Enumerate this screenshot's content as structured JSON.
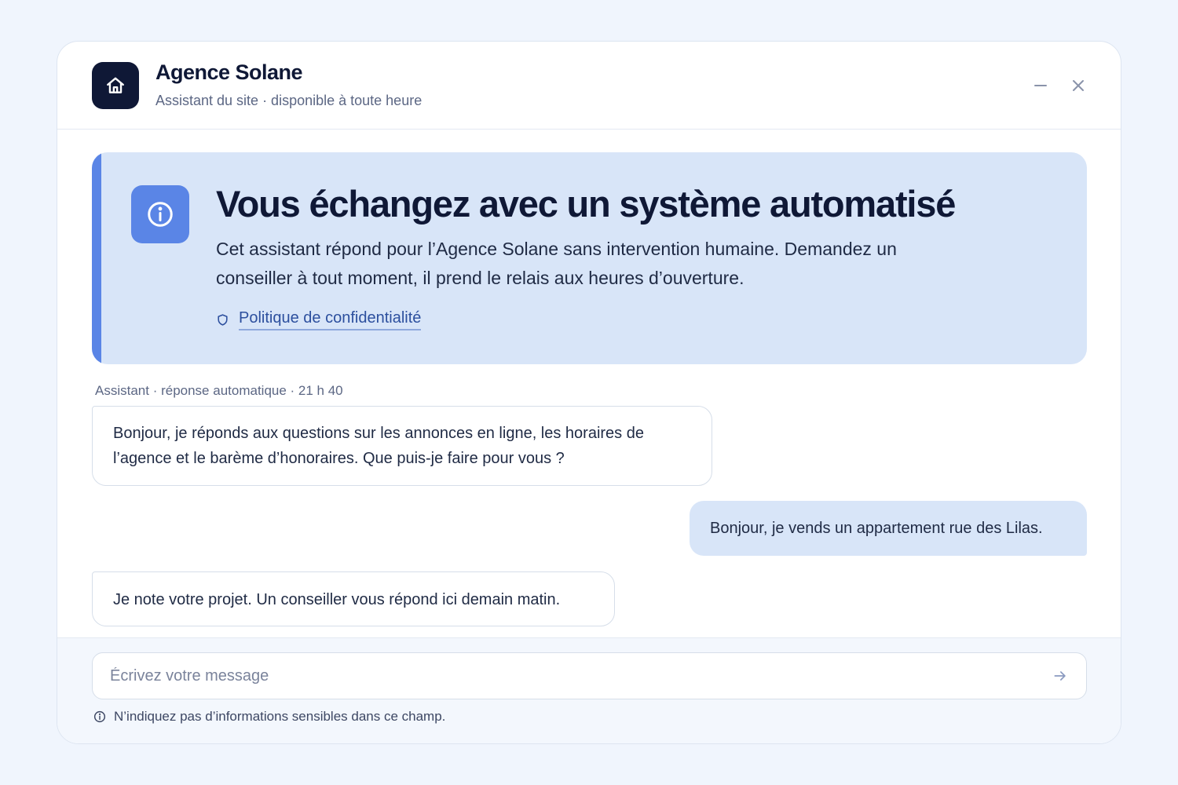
{
  "header": {
    "title": "Agence Solane",
    "subtitle": "Assistant du site · disponible à toute heure",
    "logo_icon": "house-icon",
    "minimize_icon": "minimize-icon",
    "close_icon": "close-icon"
  },
  "banner": {
    "icon": "info-icon",
    "title": "Vous échangez avec un système automatisé",
    "text": "Cet assistant répond pour l’Agence Solane sans intervention humaine. Demandez un conseiller à tout moment, il prend le relais aux heures d’ouverture.",
    "policy_icon": "shield-icon",
    "policy_link": "Politique de confidentialité"
  },
  "conversation": {
    "meta": "Assistant · réponse automatique · 21 h 40",
    "messages": [
      {
        "role": "assistant",
        "text": "Bonjour, je réponds aux questions sur les annonces en ligne, les horaires de l’agence et le barème d’honoraires. Que puis-je faire pour vous ?"
      },
      {
        "role": "user",
        "text": "Bonjour, je vends un appartement rue des Lilas."
      },
      {
        "role": "assistant",
        "text": "Je note votre projet. Un conseiller vous répond ici demain matin."
      }
    ]
  },
  "composer": {
    "placeholder": "Écrivez votre message",
    "value": "",
    "send_icon": "arrow-right-icon",
    "hint_icon": "info-icon",
    "hint": "N’indiquez pas d’informations sensibles dans ce champ."
  },
  "colors": {
    "page_bg": "#f0f5fd",
    "brand_dark": "#0f1836",
    "accent": "#5a85e6",
    "banner_bg": "#d8e5f8",
    "link": "#2c4f9e"
  }
}
